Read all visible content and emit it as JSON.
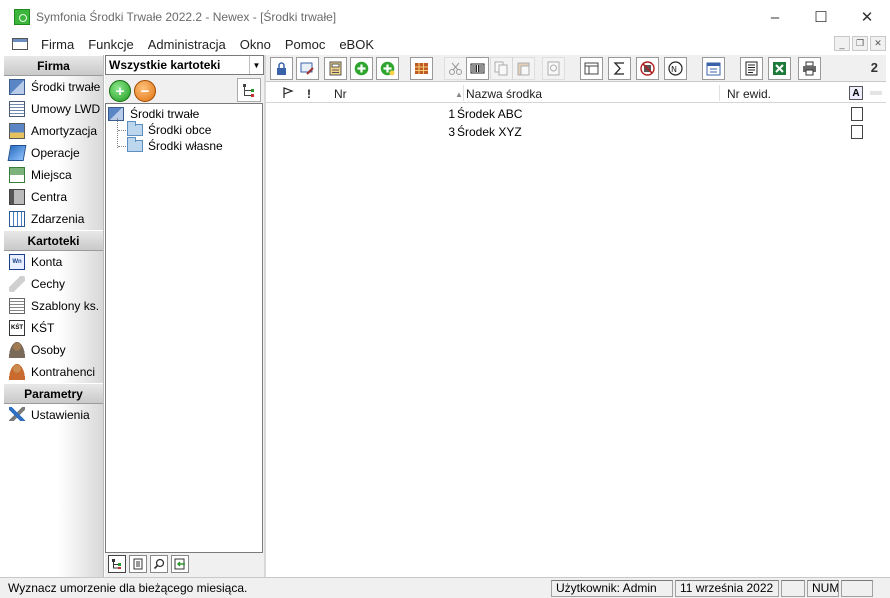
{
  "window": {
    "title": "Symfonia Środki Trwałe 2022.2 - Newex - [Środki trwałe]",
    "controls": [
      "minimize",
      "maximize",
      "close"
    ]
  },
  "menu": {
    "items": [
      "Firma",
      "Funkcje",
      "Administracja",
      "Okno",
      "Pomoc",
      "eBOK"
    ]
  },
  "navbar": {
    "groups": [
      {
        "header": "Firma",
        "items": [
          {
            "label": "Środki trwałe",
            "icon": "fixed-assets-icon"
          },
          {
            "label": "Umowy LWD",
            "icon": "contracts-icon"
          },
          {
            "label": "Amortyzacja",
            "icon": "depreciation-icon"
          },
          {
            "label": "Operacje",
            "icon": "operations-icon"
          },
          {
            "label": "Miejsca",
            "icon": "places-icon"
          },
          {
            "label": "Centra",
            "icon": "centers-icon"
          },
          {
            "label": "Zdarzenia",
            "icon": "events-icon"
          }
        ]
      },
      {
        "header": "Kartoteki",
        "items": [
          {
            "label": "Konta",
            "icon": "accounts-icon"
          },
          {
            "label": "Cechy",
            "icon": "features-icon"
          },
          {
            "label": "Szablony ks.",
            "icon": "templates-icon"
          },
          {
            "label": "KŚT",
            "icon": "kst-icon"
          },
          {
            "label": "Osoby",
            "icon": "persons-icon"
          },
          {
            "label": "Kontrahenci",
            "icon": "contractors-icon"
          }
        ]
      },
      {
        "header": "Parametry",
        "items": [
          {
            "label": "Ustawienia",
            "icon": "settings-icon"
          }
        ]
      }
    ]
  },
  "leftpanel": {
    "combo_value": "Wszystkie kartoteki",
    "tree": {
      "root": "Środki trwałe",
      "children": [
        "Środki obce",
        "Środki własne"
      ]
    },
    "bottom_tabs": [
      "tree-view",
      "document",
      "search",
      "import"
    ]
  },
  "toolbar": {
    "record_count": "2"
  },
  "grid": {
    "columns": {
      "flag": "",
      "exclamation": "!",
      "nr": "Nr",
      "nazwa": "Nazwa środka",
      "nr_ewid": "Nr ewid."
    },
    "rows": [
      {
        "nr": "1",
        "nazwa": "Środek ABC",
        "nr_ewid": ""
      },
      {
        "nr": "3",
        "nazwa": "Środek XYZ",
        "nr_ewid": ""
      }
    ]
  },
  "statusbar": {
    "message": "Wyznacz umorzenie dla bieżącego miesiąca.",
    "user": "Użytkownik: Admin",
    "date": "11 września 2022",
    "empty1": "",
    "num": "NUM",
    "empty2": ""
  },
  "colors": {
    "accent_green": "#3cb53c",
    "header_gray": "#c9c9c9"
  }
}
